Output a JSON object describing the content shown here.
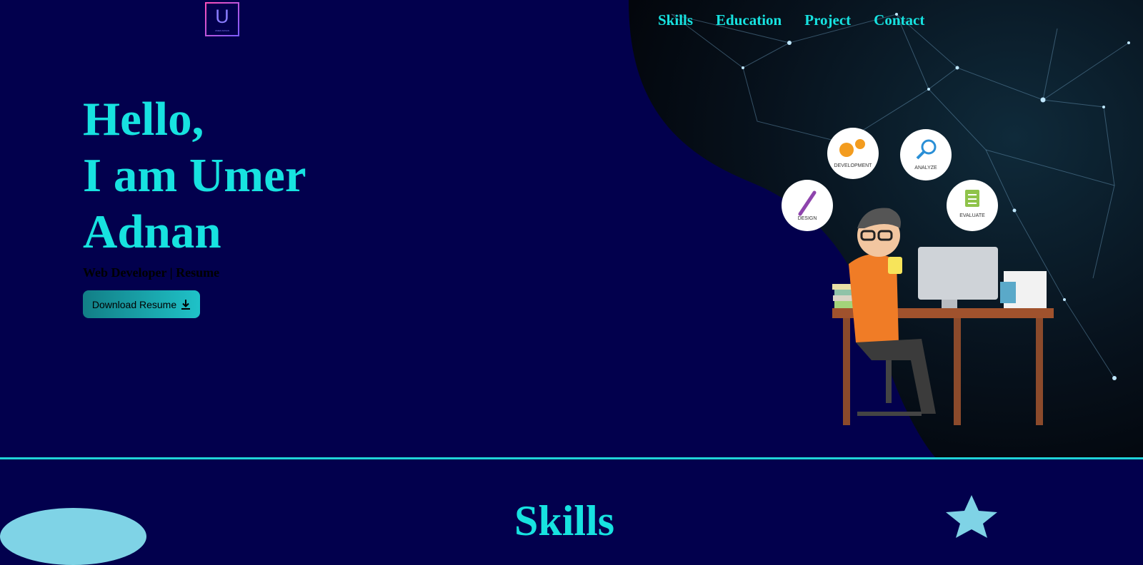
{
  "logo": {
    "letter": "U",
    "subtext": "UMER ADNAN"
  },
  "nav": [
    {
      "label": "Skills"
    },
    {
      "label": "Education"
    },
    {
      "label": "Project"
    },
    {
      "label": "Contact"
    }
  ],
  "hero": {
    "greeting_lines": [
      "Hello,",
      "I am Umer",
      "Adnan"
    ],
    "subtitle": "Web Developer | Resume",
    "download_button": "Download Resume"
  },
  "illustration": {
    "bubbles": [
      "DEVELOPMENT",
      "ANALYZE",
      "DESIGN",
      "EVALUATE"
    ]
  },
  "next_section": {
    "title": "Skills"
  },
  "colors": {
    "background": "#02004d",
    "accent": "#17e2e0",
    "logo_gradient": [
      "#ff4fb8",
      "#7a5cff"
    ]
  }
}
